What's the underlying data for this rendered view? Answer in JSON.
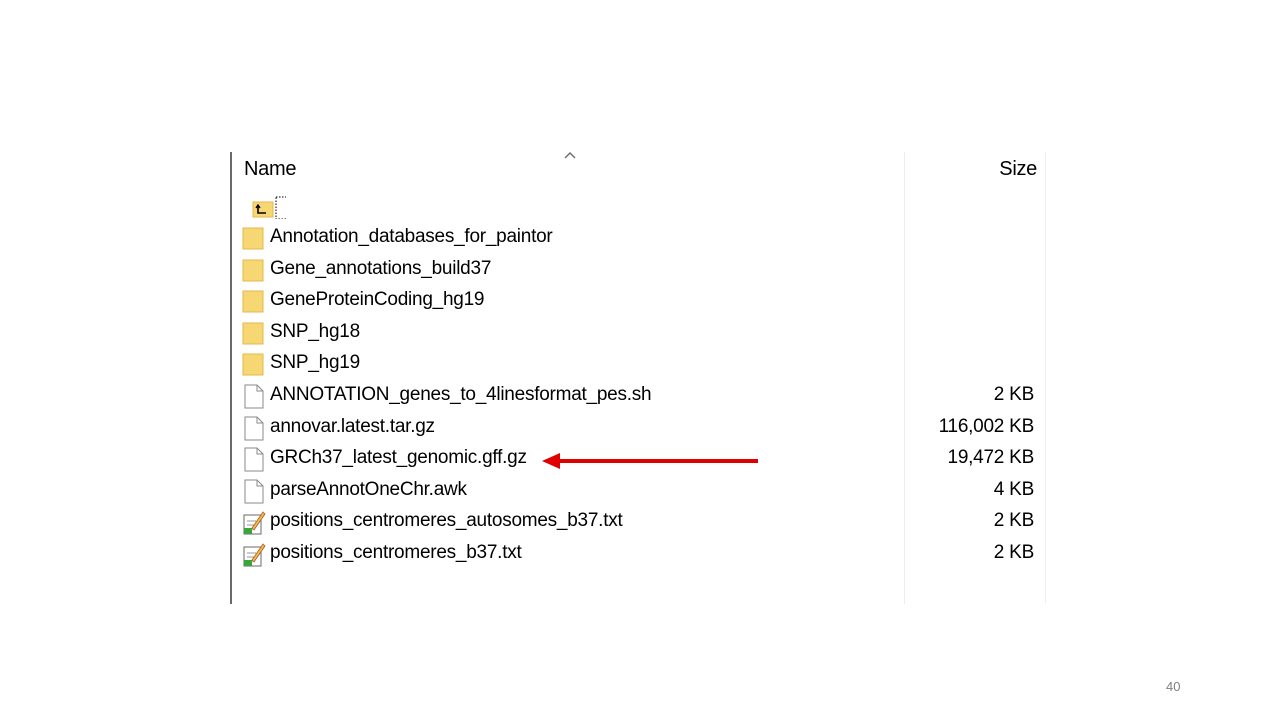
{
  "header": {
    "name_label": "Name",
    "size_label": "Size",
    "sort_icon": "chevron-up-icon"
  },
  "parent": {
    "label": "..",
    "icon": "folder-up-icon"
  },
  "files": [
    {
      "name": "Annotation_databases_for_paintor",
      "size": "",
      "type": "folder",
      "icon": "folder-icon"
    },
    {
      "name": "Gene_annotations_build37",
      "size": "",
      "type": "folder",
      "icon": "folder-icon"
    },
    {
      "name": "GeneProteinCoding_hg19",
      "size": "",
      "type": "folder",
      "icon": "folder-icon"
    },
    {
      "name": "SNP_hg18",
      "size": "",
      "type": "folder",
      "icon": "folder-icon"
    },
    {
      "name": "SNP_hg19",
      "size": "",
      "type": "folder",
      "icon": "folder-icon"
    },
    {
      "name": "ANNOTATION_genes_to_4linesformat_pes.sh",
      "size": "2 KB",
      "type": "file",
      "icon": "file-icon"
    },
    {
      "name": "annovar.latest.tar.gz",
      "size": "116,002 KB",
      "type": "file",
      "icon": "file-icon"
    },
    {
      "name": "GRCh37_latest_genomic.gff.gz",
      "size": "19,472 KB",
      "type": "file",
      "icon": "file-icon",
      "highlighted": true
    },
    {
      "name": "parseAnnotOneChr.awk",
      "size": "4 KB",
      "type": "file",
      "icon": "file-icon"
    },
    {
      "name": "positions_centromeres_autosomes_b37.txt",
      "size": "2 KB",
      "type": "text",
      "icon": "text-file-icon"
    },
    {
      "name": "positions_centromeres_b37.txt",
      "size": "2 KB",
      "type": "text",
      "icon": "text-file-icon"
    }
  ],
  "annotation": {
    "arrow_color": "#e00000",
    "arrow_icon": "red-arrow-icon"
  },
  "slide": {
    "page_number": "40"
  },
  "colors": {
    "folder": "#f7d774",
    "folder_dark": "#e2b84a",
    "file_border": "#8a8a8a"
  }
}
